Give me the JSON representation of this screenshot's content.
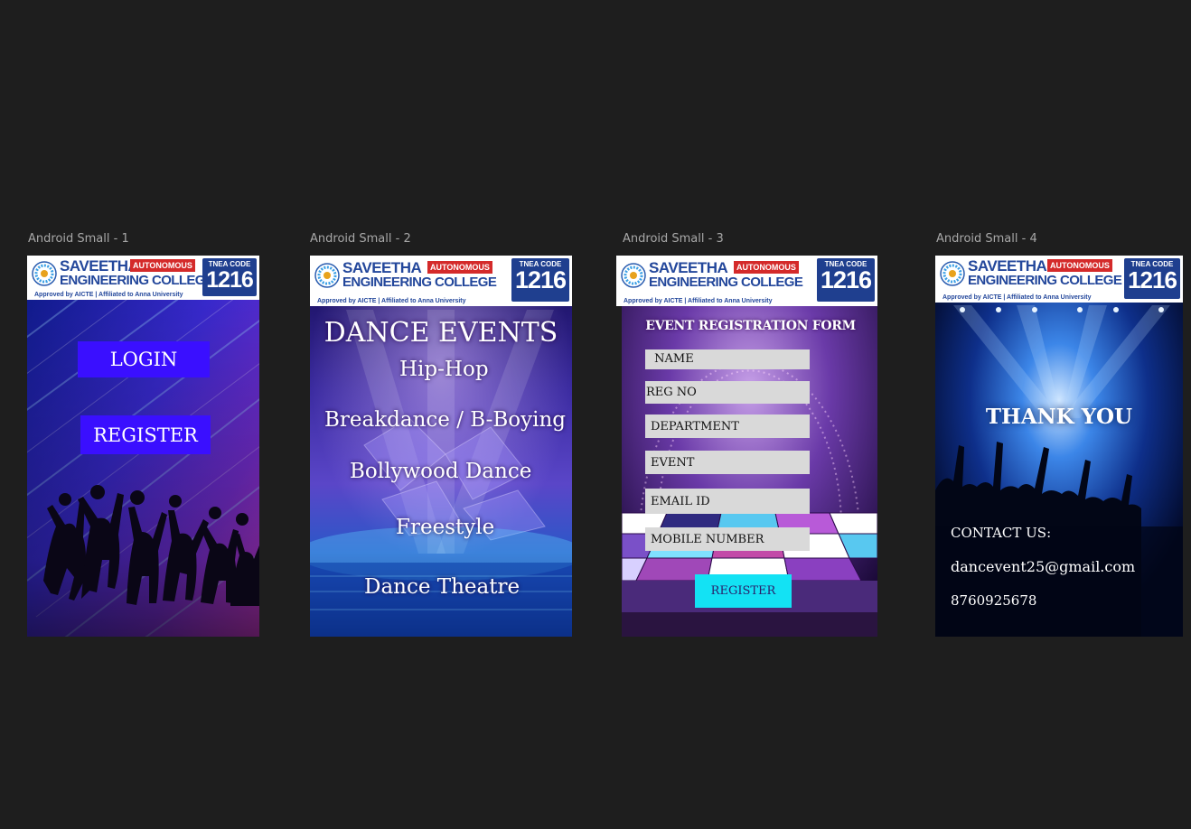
{
  "frames": [
    {
      "label": "Android Small - 1"
    },
    {
      "label": "Android Small - 2"
    },
    {
      "label": "Android Small - 3"
    },
    {
      "label": "Android Small - 4"
    }
  ],
  "banner": {
    "name_line1": "SAVEETHA",
    "autonomous": "AUTONOMOUS",
    "name_line2": "ENGINEERING COLLEGE",
    "approved": "Approved by AICTE  |  Affiliated to Anna University",
    "tnea_label": "TNEA CODE",
    "tnea_code": "1216"
  },
  "screen1": {
    "login_label": "LOGIN",
    "register_label": "REGISTER"
  },
  "screen2": {
    "title": "DANCE EVENTS",
    "events": [
      "Hip-Hop",
      "Breakdance / B-Boying",
      "Bollywood Dance",
      "Freestyle",
      "Dance Theatre"
    ]
  },
  "screen3": {
    "title": "EVENT REGISTRATION FORM",
    "fields": [
      {
        "placeholder": " NAME"
      },
      {
        "placeholder": "REG NO"
      },
      {
        "placeholder": "DEPARTMENT"
      },
      {
        "placeholder": "EVENT"
      },
      {
        "placeholder": "EMAIL ID"
      },
      {
        "placeholder": "MOBILE NUMBER"
      }
    ],
    "register_label": "REGISTER"
  },
  "screen4": {
    "thank_you": "THANK YOU",
    "contact_label": "CONTACT US:",
    "email": "dancevent25@gmail.com",
    "phone": "8760925678"
  },
  "colors": {
    "canvas": "#1e1e1e",
    "button_purple": "#3a0fff",
    "button_cyan": "#13e2f4",
    "field_gray": "#d9d9d9",
    "brand_blue": "#23479b",
    "brand_red": "#d42a2a"
  }
}
